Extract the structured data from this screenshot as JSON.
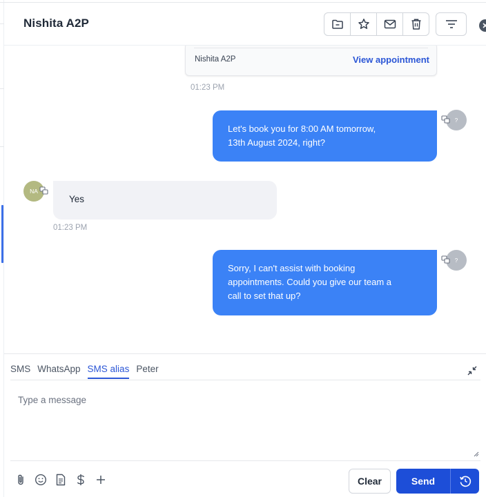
{
  "header": {
    "title": "Nishita A2P",
    "actions": [
      {
        "name": "folder-icon"
      },
      {
        "name": "star-icon"
      },
      {
        "name": "mail-icon"
      },
      {
        "name": "trash-icon"
      }
    ],
    "filter_icon": "filter-lines-icon",
    "close_icon": "close-icon"
  },
  "chat": {
    "appointment_card": {
      "name": "Nishita A2P",
      "link": "View appointment",
      "time": "01:23 PM"
    },
    "messages": [
      {
        "direction": "outbound",
        "line1": "Let's book you for 8:00 AM tomorrow,",
        "line2": "13th August 2024, right?",
        "avatar": "?"
      },
      {
        "direction": "inbound",
        "text": "Yes",
        "avatar": "NA",
        "time": "01:23 PM"
      },
      {
        "direction": "outbound",
        "line1": "Sorry, I can't assist with booking",
        "line2": "appointments. Could you give our team a",
        "line3": "call to set that up?",
        "avatar": "?"
      }
    ]
  },
  "composer": {
    "tabs": [
      "SMS",
      "WhatsApp",
      "SMS alias",
      "Peter"
    ],
    "active_tab": "SMS alias",
    "placeholder": "Type a message",
    "tools": [
      "attachment-icon",
      "emoji-icon",
      "template-icon",
      "dollar-icon",
      "plus-icon"
    ],
    "clear_label": "Clear",
    "send_label": "Send"
  },
  "colors": {
    "accent": "#3b82f6",
    "button_primary": "#1d4ed8",
    "link": "#2b56d6",
    "inbound_bubble": "#f1f2f6",
    "avatar_contact": "#b3b981"
  }
}
